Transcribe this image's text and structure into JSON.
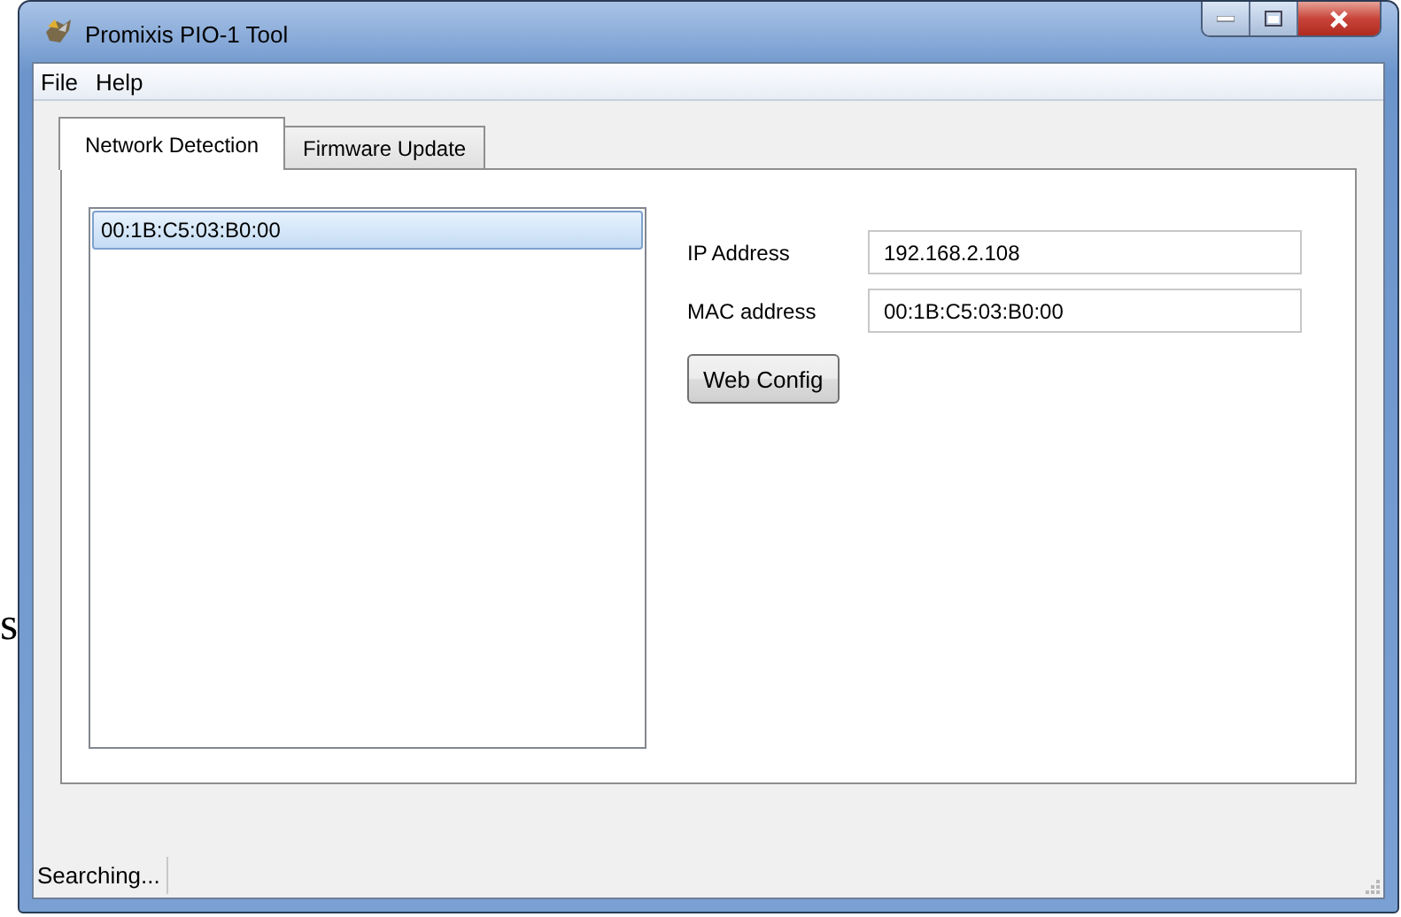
{
  "background_text": "s",
  "window": {
    "title": "Promixis PIO-1 Tool"
  },
  "menu": [
    {
      "label": "File"
    },
    {
      "label": "Help"
    }
  ],
  "tabs": [
    {
      "label": "Network Detection",
      "selected": true
    },
    {
      "label": "Firmware Update",
      "selected": false
    }
  ],
  "device_list": {
    "items": [
      {
        "label": "00:1B:C5:03:B0:00",
        "selected": true
      }
    ]
  },
  "fields": [
    {
      "label": "IP Address",
      "value": "192.168.2.108"
    },
    {
      "label": "MAC address",
      "value": "00:1B:C5:03:B0:00"
    }
  ],
  "buttons": [
    {
      "label": "Web Config"
    }
  ],
  "status_bar": {
    "text": "Searching..."
  }
}
